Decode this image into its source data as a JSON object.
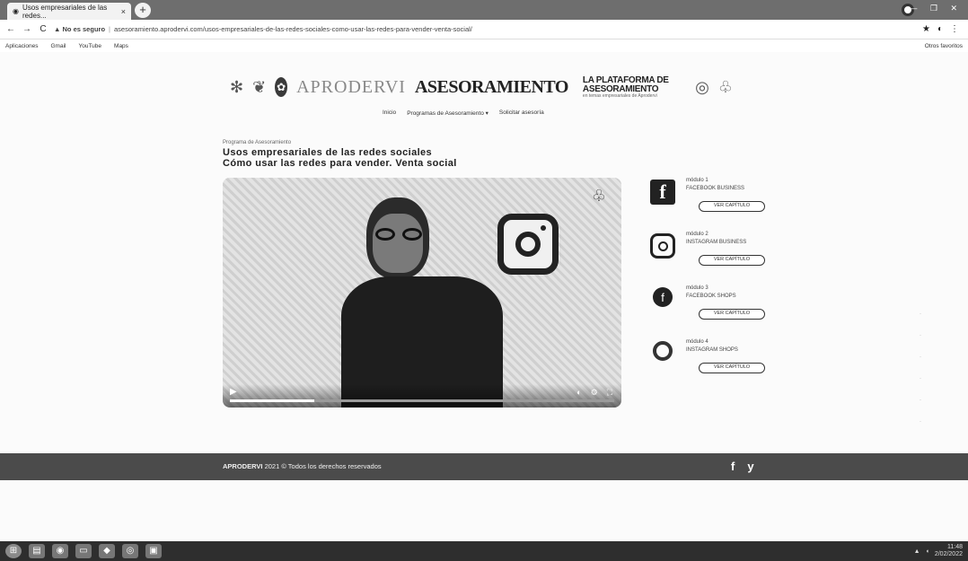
{
  "browser": {
    "tab_title": "Usos empresariales de las redes...",
    "tab_close": "×",
    "new_tab": "+",
    "window_controls": "— ❐ ✕",
    "nav": {
      "back": "←",
      "forward": "→",
      "reload": "C"
    },
    "security_warning": "▲ No es seguro",
    "url": "asesoramiento.aprodervi.com/usos-empresariales-de-las-redes-sociales-como-usar-las-redes-para-vender-venta-social/",
    "toolbar_right": [
      "★",
      "◐",
      "⋮"
    ],
    "bookmarks": [
      "Aplicaciones",
      "Gmail",
      "YouTube",
      "Maps"
    ],
    "other_bookmarks": "Otros favoritos"
  },
  "site": {
    "brand_name": "APRODERVI",
    "brand_section": "ASESORAMIENTO",
    "tagline_1": "LA PLATAFORMA DE ASESORAMIENTO",
    "tagline_2": "en temas empresariales de Aprodervi",
    "menu": [
      "Inicio",
      "Programas de Asesoramiento ▾",
      "Solicitar asesoría"
    ]
  },
  "content": {
    "breadcrumb": "Programa de Asesoramiento",
    "title_line1": "Usos empresariales de las redes sociales",
    "title_line2": "Cómo usar las redes para vender. Venta social",
    "video": {
      "progress": 0.22
    },
    "modules": [
      {
        "label": "módulo 1",
        "name": "FACEBOOK BUSINESS",
        "button": "VER CAPÍTULO",
        "icon": "facebook-icon"
      },
      {
        "label": "módulo 2",
        "name": "INSTAGRAM BUSINESS",
        "button": "VER CAPÍTULO",
        "icon": "instagram-icon"
      },
      {
        "label": "módulo 3",
        "name": "FACEBOOK SHOPS",
        "button": "VER CAPÍTULO",
        "icon": "facebook-shops-icon"
      },
      {
        "label": "módulo 4",
        "name": "INSTAGRAM SHOPS",
        "button": "VER CAPÍTULO",
        "icon": "instagram-shops-icon"
      }
    ]
  },
  "footer": {
    "brand": "APRODERVI",
    "copyright": "2021 © Todos los derechos reservados",
    "social": [
      "f",
      "y"
    ]
  },
  "taskbar": {
    "clock_time": "11:48",
    "clock_date": "2/02/2022"
  }
}
